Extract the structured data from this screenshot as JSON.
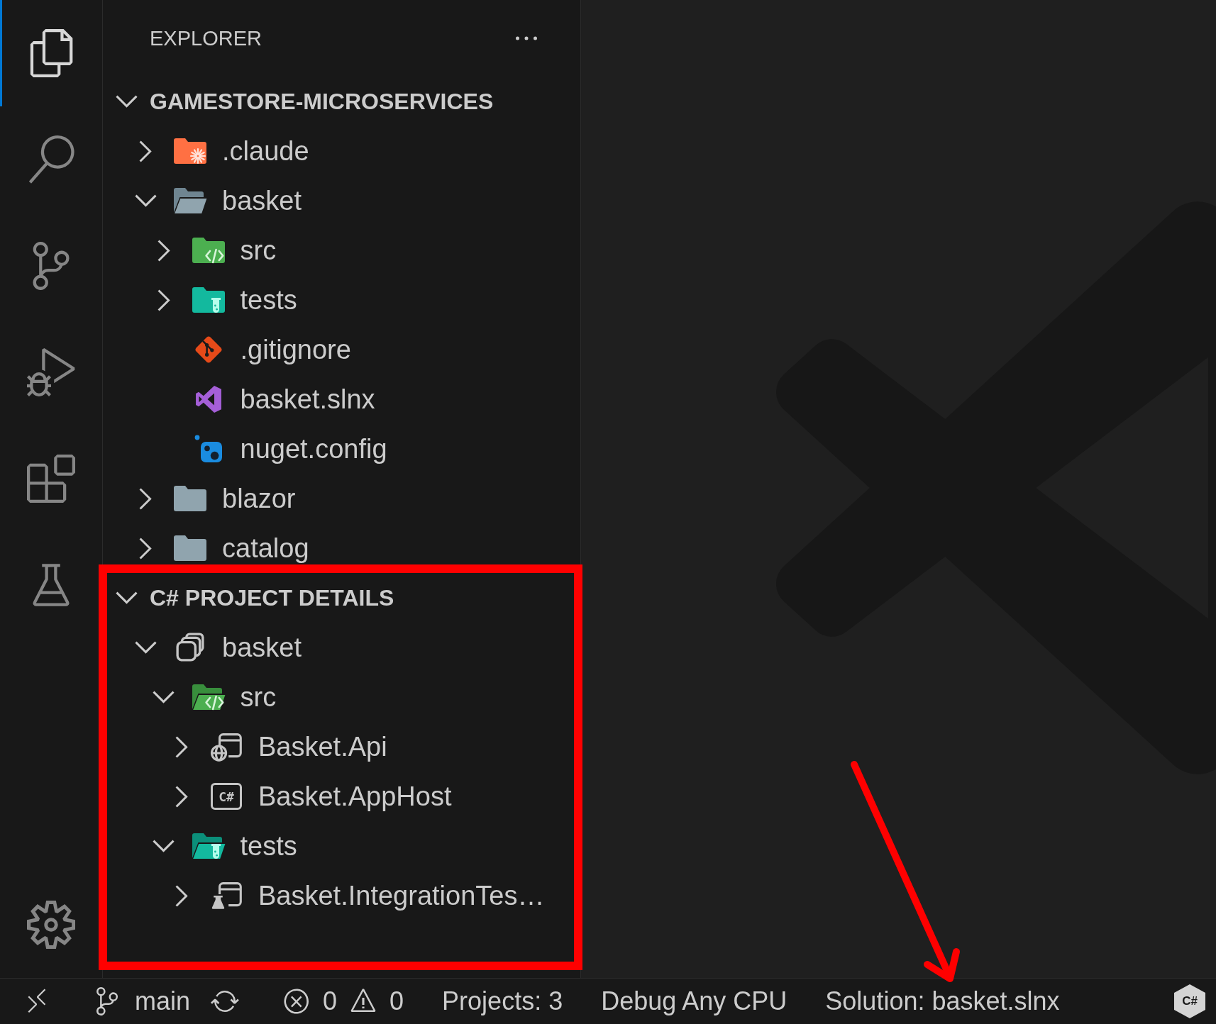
{
  "activity_bar": {
    "items": [
      {
        "kind": "explorer",
        "selected": true
      },
      {
        "kind": "search",
        "selected": false
      },
      {
        "kind": "source-control",
        "selected": false
      },
      {
        "kind": "run-debug",
        "selected": false
      },
      {
        "kind": "extensions",
        "selected": false
      },
      {
        "kind": "testing",
        "selected": false
      }
    ],
    "bottom_items": [
      {
        "kind": "settings",
        "selected": false
      }
    ]
  },
  "sidebar": {
    "title": "EXPLORER",
    "sections": [
      {
        "title": "GAMESTORE-MICROSERVICES",
        "expanded": true,
        "tree": [
          {
            "label": ".claude",
            "kind": "claude-folder",
            "expanded": false
          },
          {
            "label": "basket",
            "kind": "folder",
            "expanded": true,
            "children": [
              {
                "label": "src",
                "kind": "code-folder",
                "expanded": false
              },
              {
                "label": "tests",
                "kind": "test-folder",
                "expanded": false
              },
              {
                "label": ".gitignore",
                "kind": "git-file"
              },
              {
                "label": "basket.slnx",
                "kind": "solution-file"
              },
              {
                "label": "nuget.config",
                "kind": "nuget-file"
              }
            ]
          },
          {
            "label": "blazor",
            "kind": "folder",
            "expanded": false
          },
          {
            "label": "catalog",
            "kind": "folder",
            "expanded": false
          }
        ]
      },
      {
        "title": "C# PROJECT DETAILS",
        "expanded": true,
        "tree": [
          {
            "label": "basket",
            "kind": "solution",
            "expanded": true,
            "children": [
              {
                "label": "src",
                "kind": "code-folder",
                "expanded": true,
                "children": [
                  {
                    "label": "Basket.Api",
                    "kind": "web-project",
                    "expanded": false
                  },
                  {
                    "label": "Basket.AppHost",
                    "kind": "console-project",
                    "badge": "C#",
                    "expanded": false
                  }
                ]
              },
              {
                "label": "tests",
                "kind": "test-folder",
                "expanded": true,
                "children": [
                  {
                    "label": "Basket.IntegrationTes…",
                    "kind": "test-project",
                    "expanded": false
                  }
                ]
              }
            ]
          }
        ]
      }
    ]
  },
  "status_bar": {
    "items": [
      {
        "kind": "remote"
      },
      {
        "kind": "branch",
        "text": "main"
      },
      {
        "kind": "sync"
      },
      {
        "kind": "errors",
        "text": "0"
      },
      {
        "kind": "warnings",
        "text": "0"
      },
      {
        "kind": "label",
        "text": "Projects: 3"
      },
      {
        "kind": "label",
        "text": "Debug Any CPU"
      },
      {
        "kind": "label",
        "text": "Solution: basket.slnx"
      },
      {
        "kind": "language",
        "text": "C#"
      }
    ]
  },
  "annotations": {
    "highlight_box": true,
    "arrow": true
  }
}
